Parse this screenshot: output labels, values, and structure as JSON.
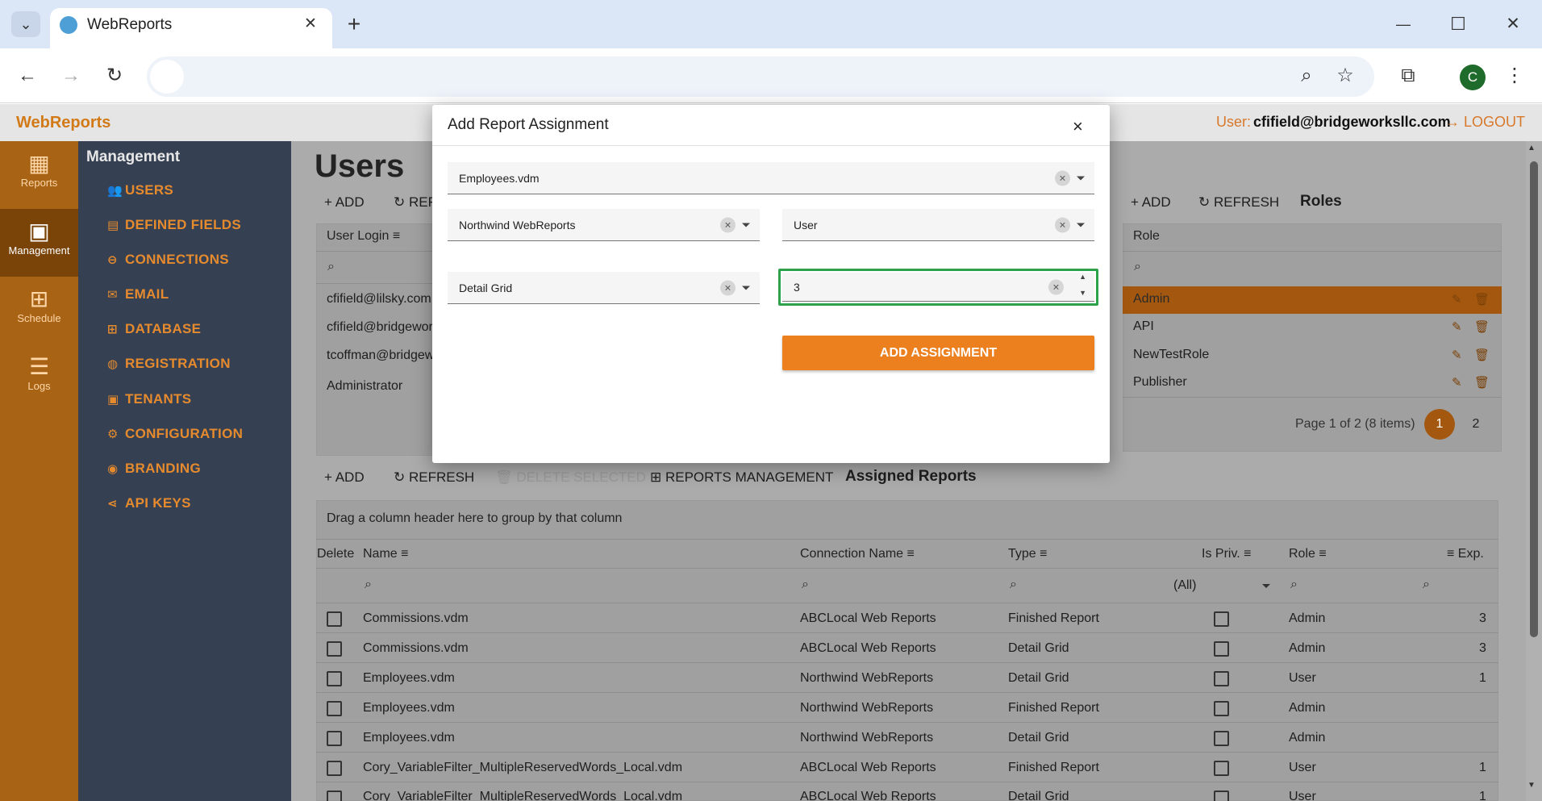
{
  "browser": {
    "tab_title": "WebReports",
    "new_tab": "+",
    "minimize": "—",
    "maximize": "☐",
    "close": "✕",
    "avatar_letter": "C"
  },
  "app": {
    "brand": "WebReports",
    "user_label": "User:",
    "user_email": "cfifield@bridgeworksllc.com",
    "logout": "LOGOUT",
    "accent": "#e68a2e"
  },
  "side_nav": [
    {
      "label": "Reports",
      "icon": "bar-chart-icon"
    },
    {
      "label": "Management",
      "icon": "id-card-icon",
      "active": true
    },
    {
      "label": "Schedule",
      "icon": "grid-icon"
    },
    {
      "label": "Logs",
      "icon": "list-icon"
    }
  ],
  "management": {
    "title": "Management",
    "links": [
      "USERS",
      "DEFINED FIELDS",
      "CONNECTIONS",
      "EMAIL",
      "DATABASE",
      "REGISTRATION",
      "TENANTS",
      "CONFIGURATION",
      "BRANDING",
      "API KEYS"
    ]
  },
  "users": {
    "title": "Users",
    "add": "ADD",
    "refresh": "REFRESH",
    "column": "User Login",
    "rows": [
      "cfifield@lilsky.com",
      "cfifield@bridgewor",
      "tcoffman@bridgew",
      "Administrator"
    ]
  },
  "roles": {
    "add": "ADD",
    "refresh": "REFRESH",
    "title": "Roles",
    "column": "Role",
    "rows": [
      "Admin",
      "API",
      "NewTestRole",
      "Publisher"
    ],
    "pager_info": "Page 1 of 2 (8 items)",
    "pages": [
      "1",
      "2"
    ]
  },
  "assigned": {
    "add": "ADD",
    "refresh": "REFRESH",
    "delete_selected": "DELETE SELECTED",
    "reports_management": "REPORTS MANAGEMENT",
    "title": "Assigned Reports",
    "group_hint": "Drag a column header here to group by that column",
    "columns": [
      "Delete",
      "Name",
      "Connection Name",
      "Type",
      "Is Priv.",
      "Role",
      "Exp."
    ],
    "filter_all": "(All)",
    "rows": [
      {
        "name": "Commissions.vdm",
        "conn": "ABCLocal Web Reports",
        "type": "Finished Report",
        "role": "Admin",
        "exp": "3"
      },
      {
        "name": "Commissions.vdm",
        "conn": "ABCLocal Web Reports",
        "type": "Detail Grid",
        "role": "Admin",
        "exp": "3"
      },
      {
        "name": "Employees.vdm",
        "conn": "Northwind WebReports",
        "type": "Detail Grid",
        "role": "User",
        "exp": "1"
      },
      {
        "name": "Employees.vdm",
        "conn": "Northwind WebReports",
        "type": "Finished Report",
        "role": "Admin",
        "exp": ""
      },
      {
        "name": "Employees.vdm",
        "conn": "Northwind WebReports",
        "type": "Detail Grid",
        "role": "Admin",
        "exp": ""
      },
      {
        "name": "Cory_VariableFilter_MultipleReservedWords_Local.vdm",
        "conn": "ABCLocal Web Reports",
        "type": "Finished Report",
        "role": "User",
        "exp": "1"
      },
      {
        "name": "Cory_VariableFilter_MultipleReservedWords_Local.vdm",
        "conn": "ABCLocal Web Reports",
        "type": "Detail Grid",
        "role": "User",
        "exp": "1"
      }
    ]
  },
  "modal": {
    "title": "Add Report Assignment",
    "close": "×",
    "report_value": "Employees.vdm",
    "connection_value": "Northwind WebReports",
    "role_value": "User",
    "type_value": "Detail Grid",
    "expiration_value": "3",
    "add_button": "ADD ASSIGNMENT"
  }
}
